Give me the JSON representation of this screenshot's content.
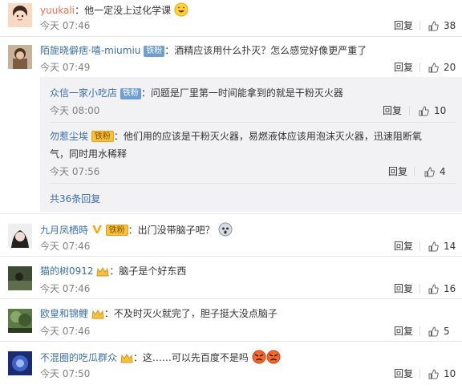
{
  "comments": [
    {
      "username": "yuukali",
      "text": "：他一定没上过化学课",
      "time": "今天 07:46",
      "reply_label": "回复",
      "likes": "38"
    },
    {
      "username": "陌旎晓僻痞·嘻-miumiu",
      "badge": "铁粉",
      "text": "：酒精应该用什么扑灭？怎么感觉好像更严重了",
      "time": "今天 07:49",
      "reply_label": "回复",
      "likes": "20",
      "replies": [
        {
          "username": "众信一家小吃店",
          "badge": "铁粉",
          "text": "：问题是厂里第一时间能拿到的就是干粉灭火器",
          "time": "今天 08:00",
          "reply_label": "回复",
          "likes": "10"
        },
        {
          "username": "勿惹尘埃",
          "badge": "铁粉",
          "text_line1": "：他们用的应该是干粉灭火器，易燃液体应该用泡沫灭火器，迅速阻断氧",
          "text_line2": "气，同时用水稀释",
          "time": "今天 07:56",
          "reply_label": "回复",
          "likes": "4"
        }
      ],
      "more_replies": "共36条回复"
    },
    {
      "username": "九月凤栖時",
      "badge": "铁粉",
      "text": "：出门没带脑子吧？",
      "time": "今天 07:46",
      "reply_label": "回复",
      "likes": "14"
    },
    {
      "username": "猫的树0912",
      "text": "：脑子是个好东西",
      "time": "今天 07:46",
      "reply_label": "回复",
      "likes": "16"
    },
    {
      "username": "欧皇和锦鲤",
      "text": "：不及时灭火就完了，胆子挺大没点脑子",
      "time": "今天 07:46",
      "reply_label": "回复",
      "likes": "5"
    },
    {
      "username": "不混圈的吃瓜群众",
      "text": "：这……可以先百度不是吗",
      "time": "今天 07:50",
      "reply_label": "回复",
      "likes": "10"
    }
  ],
  "colors": {
    "username": "#eb7350",
    "link_blue": "#3a6fa8",
    "time_gray": "#808080",
    "sub_bg": "#f2f2f5"
  },
  "icons": {
    "like": "thumbs-up-icon",
    "vip": "vip-v-icon",
    "emoji_laugh": "laughing-face-emoji",
    "emoji_angry": "angry-face-emoji"
  }
}
